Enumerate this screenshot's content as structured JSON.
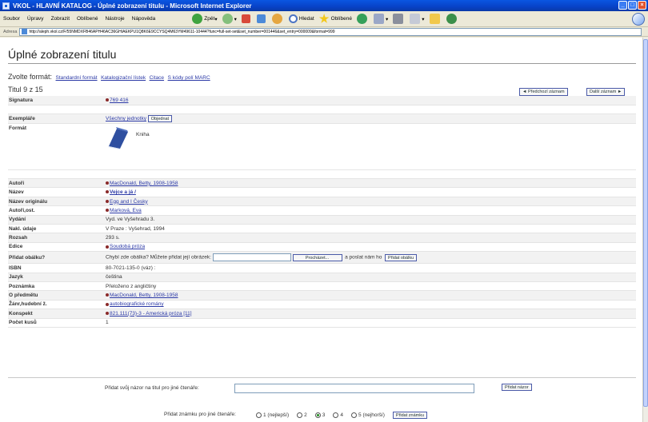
{
  "window": {
    "title": "VKOL - HLAVNÍ KATALOG - Úplné zobrazení titulu - Microsoft Internet Explorer"
  },
  "menu": [
    "Soubor",
    "Úpravy",
    "Zobrazit",
    "Oblíbené",
    "Nástroje",
    "Nápověda"
  ],
  "toolbar": {
    "back_label": "Zpět",
    "search_label": "Hledat",
    "favorites_label": "Oblíbené"
  },
  "address": {
    "label": "Adresa",
    "url": "http://aleph.vkol.cz/F/55NMDXFB46APH46AC36GHIAEKPU1Q8K6E9CCYSQ4M63YM49611-10444?func=full-set-set&set_number=001446&set_entry=000009&format=999"
  },
  "page": {
    "heading": "Úplné zobrazení titulu",
    "format_label": "Zvolte formát:",
    "formats": [
      "Standardní formát",
      "Katalogizační lístek",
      "Citace",
      "S kódy polí MARC"
    ],
    "record_position": "Titul 9 z 15",
    "prev_button": "◄ Předchozí záznam",
    "next_button": "Další záznam ►"
  },
  "record": {
    "signatura": {
      "label": "Signatura",
      "value": "769 416"
    },
    "exemplare": {
      "label": "Exempláře",
      "link": "Všechny jednotky",
      "button": "Objednat"
    },
    "format": {
      "label": "Formát",
      "value": "Kniha"
    },
    "autori": {
      "label": "Autoři",
      "value": "MacDonald, Betty, 1908-1958"
    },
    "nazev": {
      "label": "Název",
      "value": "Vejce a já /"
    },
    "nazev_originalu": {
      "label": "Název originálu",
      "value": "Egg and I Česky"
    },
    "autori_ost": {
      "label": "Autoři,ost.",
      "value": "Marková, Eva"
    },
    "vydani": {
      "label": "Vydání",
      "value": "Vyd. ve Vyšehradu 3."
    },
    "nakl_udaje": {
      "label": "Nakl. údaje",
      "value": "V Praze : Vyšehrad, 1994"
    },
    "rozsah": {
      "label": "Rozsah",
      "value": "293 s."
    },
    "edice": {
      "label": "Edice",
      "value": "Soudobá próza"
    },
    "pridat_obalku": {
      "label": "Přidat obálku?",
      "text": "Chybí zde obálka? Můžete přidat její obrázek:",
      "browse_button": "Procházet...",
      "send_text": "a poslat nám ho",
      "add_button": "Přidat obálku"
    },
    "isbn": {
      "label": "ISBN",
      "value": "80-7021-135-0 (váz) :"
    },
    "jazyk": {
      "label": "Jazyk",
      "value": "čeština"
    },
    "poznamka": {
      "label": "Poznámka",
      "value": "Přeloženo z angličtiny"
    },
    "o_predmetu": {
      "label": "O předmětu",
      "value": "MacDonald, Betty, 1908-1958"
    },
    "zanr": {
      "label": "Žánr,hudební ž.",
      "value": "autobiografické romány"
    },
    "konspekt": {
      "label": "Konspekt",
      "value": "821.111(73)-3 - Americká próza [11]"
    },
    "pocet_kusu": {
      "label": "Počet kusů",
      "value": "1"
    }
  },
  "opinion": {
    "label": "Přidat svůj názor na titul pro jiné čtenáře:",
    "button": "Přidat názor"
  },
  "rating": {
    "label": "Přidat známku pro jiné čtenáře:",
    "options": [
      "1 (nejlepší)",
      "2",
      "3",
      "4",
      "5 (nejhorší)"
    ],
    "selected_index": 2,
    "button": "Přidat známku"
  }
}
